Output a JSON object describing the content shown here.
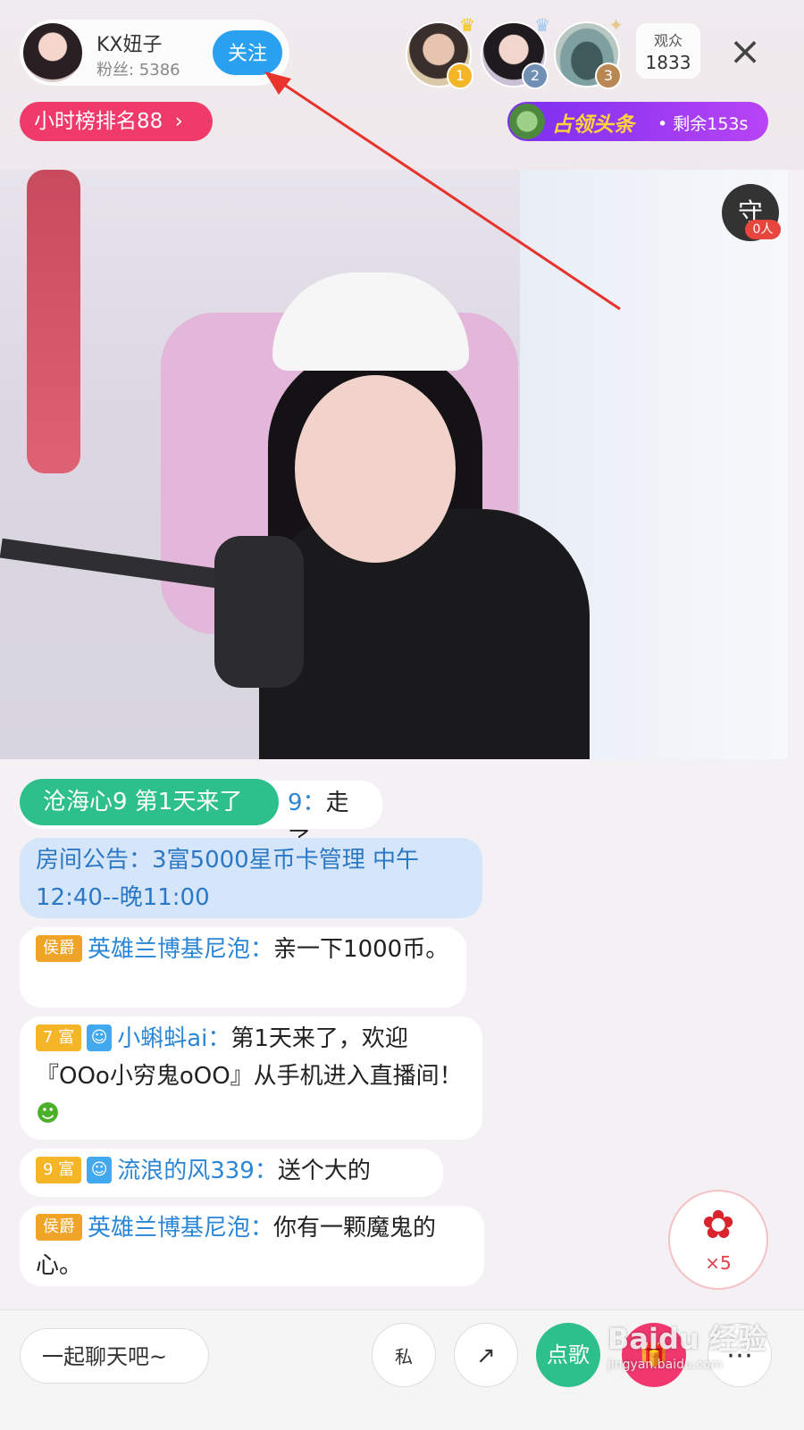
{
  "host": {
    "name": "KX妞子",
    "fans": "粉丝: 5386",
    "follow_label": "关注"
  },
  "top_rank": [
    {
      "rank": "1",
      "badge_color": "#f4b526"
    },
    {
      "rank": "2",
      "badge_color": "#6f8fb4"
    },
    {
      "rank": "3",
      "badge_color": "#b88752"
    }
  ],
  "viewers": {
    "label": "观众",
    "count": "1833"
  },
  "close_icon": "close-icon",
  "hour_rank": {
    "label": "小时榜排名88"
  },
  "headline": {
    "title": "占领头条",
    "remain": "• 剩余153s"
  },
  "guard": {
    "icon": "守",
    "count": "0人"
  },
  "welcome": "沧海心9 第1天来了",
  "chat": [
    {
      "prefix": "9",
      "sep": "：",
      "text": "走了"
    },
    {
      "text": "房间公告：3富5000星币卡管理 中午12:40--晚11:00"
    },
    {
      "tag": "侯爵",
      "user": "英雄兰博基尼泡",
      "sep": "：",
      "text": "亲一下1000币。"
    },
    {
      "tag": "7 富",
      "user": "小蝌蚪ai",
      "sep": "：",
      "text": "第1天来了，欢迎『OOo小穷鬼oOO』从手机进入直播间！"
    },
    {
      "tag": "9 富",
      "user": "流浪的风339",
      "sep": "：",
      "text": "送个大的"
    },
    {
      "tag": "侯爵",
      "user": "英雄兰博基尼泡",
      "sep": "：",
      "text": "你有一颗魔鬼的心。"
    }
  ],
  "gift": {
    "count": "×5"
  },
  "bottom": {
    "chat_placeholder": "一起聊天吧~",
    "private_label": "私",
    "song_label": "点歌",
    "watermark": "Baidu 经验",
    "watermark_url": "jingyan.baidu.com"
  },
  "colors": {
    "accent_blue": "#2aa0f0",
    "rank_pink": "#f03a6c",
    "green": "#2dc08a",
    "arrow_red": "#e8322c"
  }
}
